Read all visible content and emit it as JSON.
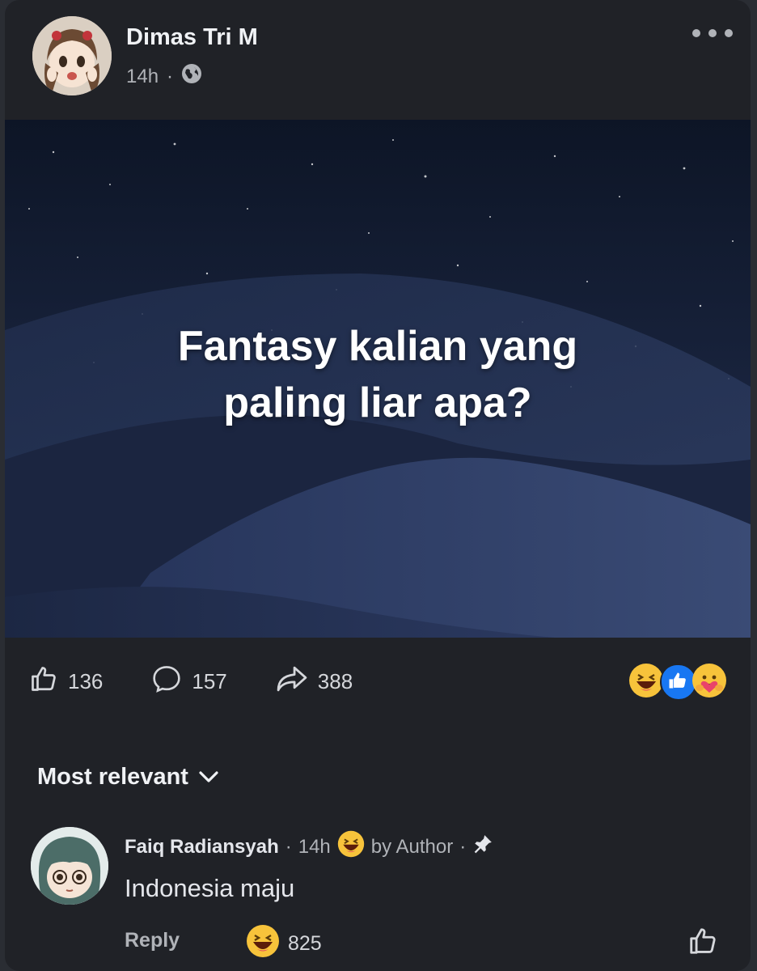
{
  "post": {
    "author": "Dimas Tri M",
    "time": "14h",
    "separator": "·",
    "privacy_icon": "globe-icon",
    "image_text_line1": "Fantasy kalian yang",
    "image_text_line2": "paling liar apa?"
  },
  "stats": {
    "likes": "136",
    "comments": "157",
    "shares": "388",
    "reaction_icons": [
      "haha-icon",
      "like-icon",
      "care-icon"
    ]
  },
  "comments_section": {
    "sort_label": "Most relevant"
  },
  "comment": {
    "author": "Faiq Radiansyah",
    "separator": "·",
    "time": "14h",
    "author_reaction_label": "by Author",
    "separator2": "·",
    "text": "Indonesia maju",
    "reply_label": "Reply",
    "reaction_count": "825"
  },
  "colors": {
    "card_bg": "#202227",
    "page_bg": "#2a2d33",
    "text_primary": "#e4e6eb",
    "text_secondary": "#b0b3b8",
    "like_blue": "#1877f2",
    "haha_yellow": "#f7c33b"
  }
}
